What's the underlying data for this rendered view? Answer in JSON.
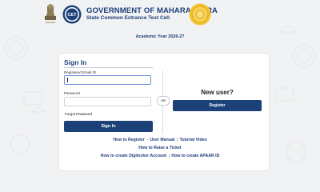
{
  "header": {
    "emblem_text": "सत्यमेव जयते",
    "cet_logo_text": "CET",
    "title": "GOVERNMENT OF MAHARASHTRA",
    "subtitle": "State Common Entrance Test Cell"
  },
  "academic_year": "Academic Year 2026-27",
  "signin": {
    "title": "Sign In",
    "email_label": "Registered Email ID",
    "email_value": "",
    "password_label": "Password",
    "password_value": "",
    "forgot_label": "Forgot Password",
    "button_label": "Sign In"
  },
  "divider": {
    "or_label": "OR"
  },
  "register": {
    "title": "New user?",
    "button_label": "Register"
  },
  "footer_links": {
    "how_to_register": "How to Register",
    "separator": "-",
    "user_manual": "User Manual",
    "pipe": "|",
    "tutorial_video": "Tutorial Video",
    "raise_ticket": "How to Raise a Ticket",
    "digilocker": "How to create Digilocker Account",
    "apaar": "How to create APAAR ID"
  },
  "colors": {
    "brand": "#1b4178",
    "title_text": "#1d3f7c",
    "input_focus": "#6b8fd6",
    "background": "#f1f2f3"
  }
}
